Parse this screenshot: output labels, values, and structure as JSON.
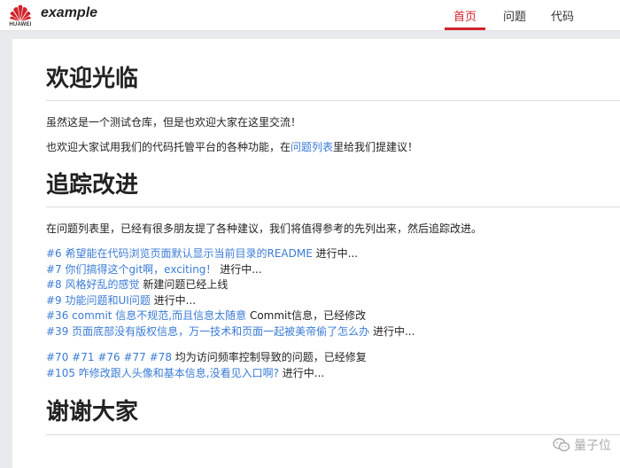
{
  "header": {
    "logo_text": "HUAWEI",
    "brand": "example",
    "nav": [
      {
        "label": "首页",
        "active": true
      },
      {
        "label": "问题",
        "active": false
      },
      {
        "label": "代码",
        "active": false
      }
    ]
  },
  "welcome": {
    "title": "欢迎光临",
    "p1": "虽然这是一个测试仓库，但是也欢迎大家在这里交流！",
    "p2_before": "也欢迎大家试用我们的代码托管平台的各种功能，在",
    "p2_link": "问题列表",
    "p2_after": "里给我们提建议！"
  },
  "tracking": {
    "title": "追踪改进",
    "intro": "在问题列表里，已经有很多朋友提了各种建议，我们将值得参考的先列出来，然后追踪改进。",
    "group1": [
      {
        "link": "#6 希望能在代码浏览页面默认显示当前目录的README",
        "status": " 进行中..."
      },
      {
        "link": "#7 你们搞得这个git啊，exciting！",
        "status": " 进行中..."
      },
      {
        "link": "#8 风格好乱的感觉",
        "status": " 新建问题已经上线"
      },
      {
        "link": "#9 功能问题和UI问题",
        "status": " 进行中..."
      },
      {
        "link": "#36 commit 信息不规范,而且信息太随意",
        "status": " Commit信息，已经修改"
      },
      {
        "link": "#39 页面底部没有版权信息，万一技术和页面一起被美帝偷了怎么办",
        "status": " 进行中..."
      }
    ],
    "group2_links": [
      "#70",
      "#71",
      "#76",
      "#77",
      "#78"
    ],
    "group2_status": " 均为访问频率控制导致的问题，已经修复",
    "group2_item2": {
      "link": "#105 咋修改跟人头像和基本信息,没看见入口啊?",
      "status": " 进行中..."
    }
  },
  "thanks": {
    "title": "谢谢大家"
  },
  "watermark": {
    "text": "量子位",
    "icon": "wechat-icon"
  },
  "colors": {
    "accent": "#d0232b",
    "link": "#3a7bd5"
  }
}
